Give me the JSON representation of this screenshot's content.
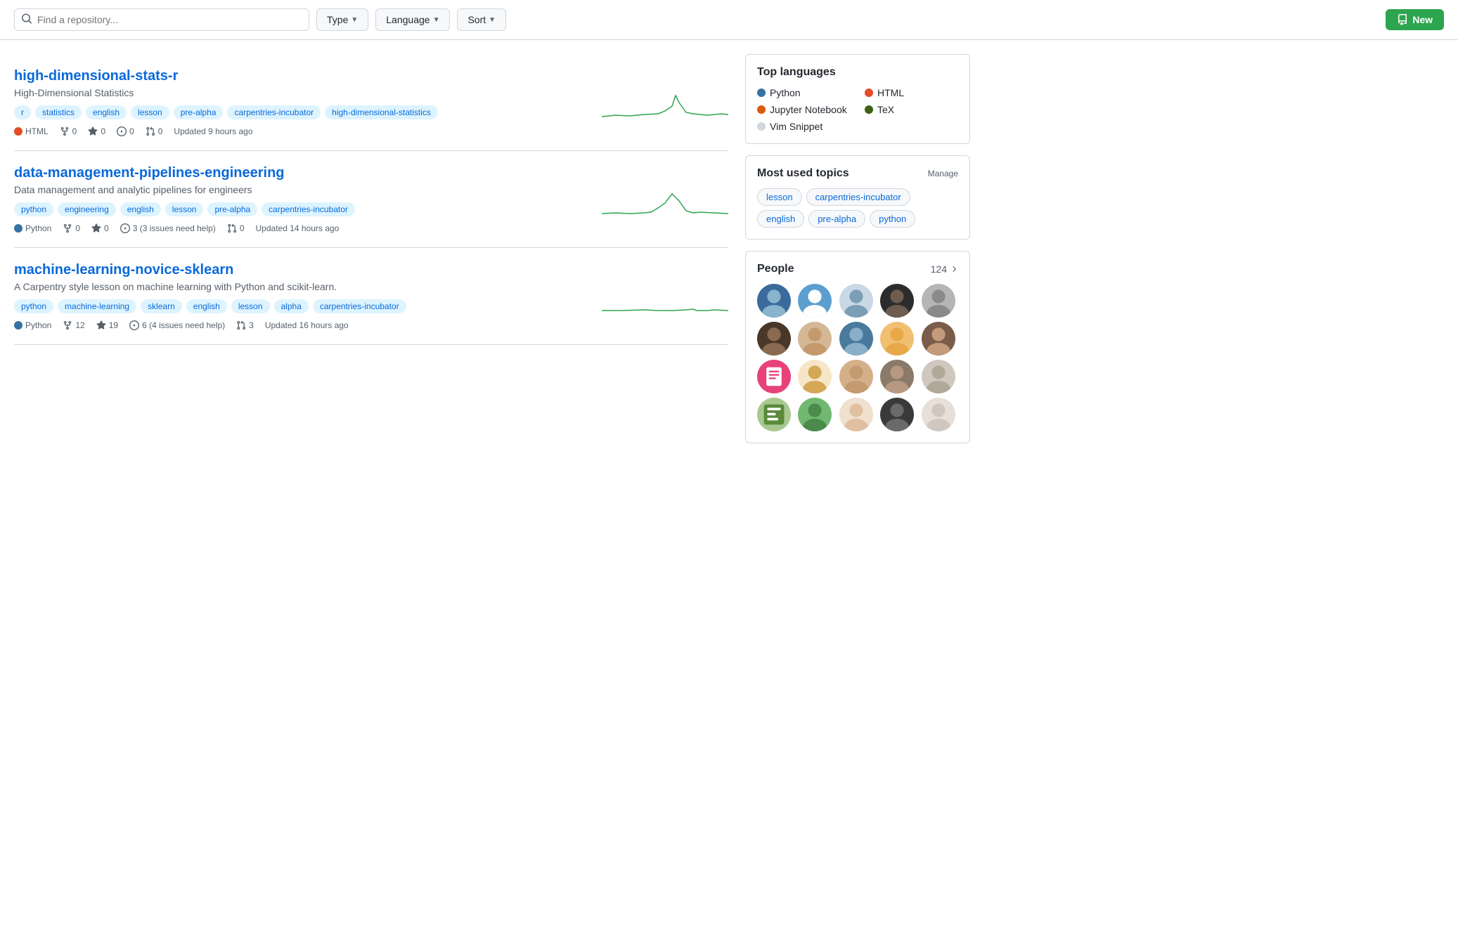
{
  "topbar": {
    "search_placeholder": "Find a repository...",
    "type_label": "Type",
    "language_label": "Language",
    "sort_label": "Sort",
    "new_label": "New"
  },
  "repos": [
    {
      "id": "repo-1",
      "name": "high-dimensional-stats-r",
      "description": "High-Dimensional Statistics",
      "tags": [
        "r",
        "statistics",
        "english",
        "lesson",
        "pre-alpha",
        "carpentries-incubator",
        "high-dimensional-statistics"
      ],
      "language": "HTML",
      "lang_color": "#e34c26",
      "forks": 0,
      "stars": 0,
      "issues": 0,
      "prs": 0,
      "updated": "Updated 9 hours ago"
    },
    {
      "id": "repo-2",
      "name": "data-management-pipelines-engineering",
      "description": "Data management and analytic pipelines for engineers",
      "tags": [
        "python",
        "engineering",
        "english",
        "lesson",
        "pre-alpha",
        "carpentries-incubator"
      ],
      "language": "Python",
      "lang_color": "#3572A5",
      "forks": 0,
      "stars": 0,
      "issues": "3 (3 issues need help)",
      "prs": 0,
      "updated": "Updated 14 hours ago"
    },
    {
      "id": "repo-3",
      "name": "machine-learning-novice-sklearn",
      "description": "A Carpentry style lesson on machine learning with Python and scikit-learn.",
      "tags": [
        "python",
        "machine-learning",
        "sklearn",
        "english",
        "lesson",
        "alpha",
        "carpentries-incubator"
      ],
      "language": "Python",
      "lang_color": "#3572A5",
      "forks": 12,
      "stars": 19,
      "issues": "6 (4 issues need help)",
      "prs": 3,
      "updated": "Updated 16 hours ago"
    }
  ],
  "sidebar": {
    "top_languages_title": "Top languages",
    "languages": [
      {
        "name": "Python",
        "color": "#3572A5"
      },
      {
        "name": "HTML",
        "color": "#e34c26"
      },
      {
        "name": "Jupyter Notebook",
        "color": "#DA5B0B"
      },
      {
        "name": "TeX",
        "color": "#3D6117"
      },
      {
        "name": "Vim Snippet",
        "color": "#d0d7de"
      }
    ],
    "most_used_topics_title": "Most used topics",
    "manage_label": "Manage",
    "topics": [
      "lesson",
      "carpentries-incubator",
      "english",
      "pre-alpha",
      "python"
    ],
    "people_title": "People",
    "people_count": "124"
  }
}
